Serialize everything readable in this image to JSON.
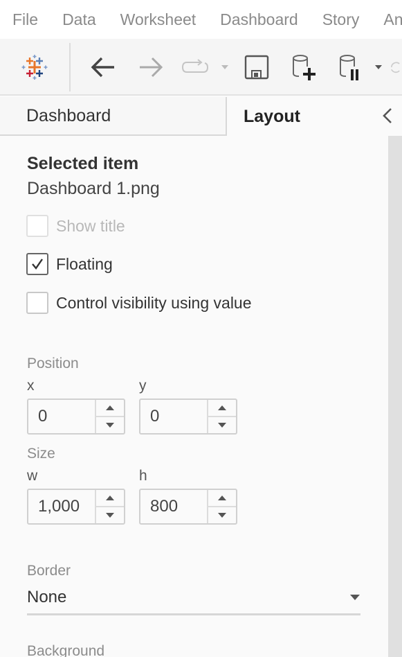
{
  "menu": [
    "File",
    "Data",
    "Worksheet",
    "Dashboard",
    "Story",
    "Analysis"
  ],
  "toolbar": {
    "icons": [
      "tableau-logo-icon",
      "back-arrow-icon",
      "forward-arrow-icon",
      "redo-icon",
      "dropdown-icon",
      "save-icon",
      "new-data-source-icon",
      "pause-auto-updates-icon",
      "dropdown-icon",
      "refresh-icon"
    ]
  },
  "tabs": {
    "dashboard": "Dashboard",
    "layout": "Layout",
    "active": "Layout"
  },
  "selected_item": {
    "heading": "Selected item",
    "value": "Dashboard 1.png"
  },
  "checkboxes": [
    {
      "label": "Show title",
      "checked": false,
      "disabled": true
    },
    {
      "label": "Floating",
      "checked": true,
      "disabled": false
    },
    {
      "label": "Control visibility using value",
      "checked": false,
      "disabled": false
    }
  ],
  "position": {
    "label": "Position",
    "x_label": "x",
    "x_value": "0",
    "y_label": "y",
    "y_value": "0"
  },
  "size": {
    "label": "Size",
    "w_label": "w",
    "w_value": "1,000",
    "h_label": "h",
    "h_value": "800"
  },
  "border": {
    "label": "Border",
    "value": "None"
  },
  "background": {
    "label": "Background"
  }
}
